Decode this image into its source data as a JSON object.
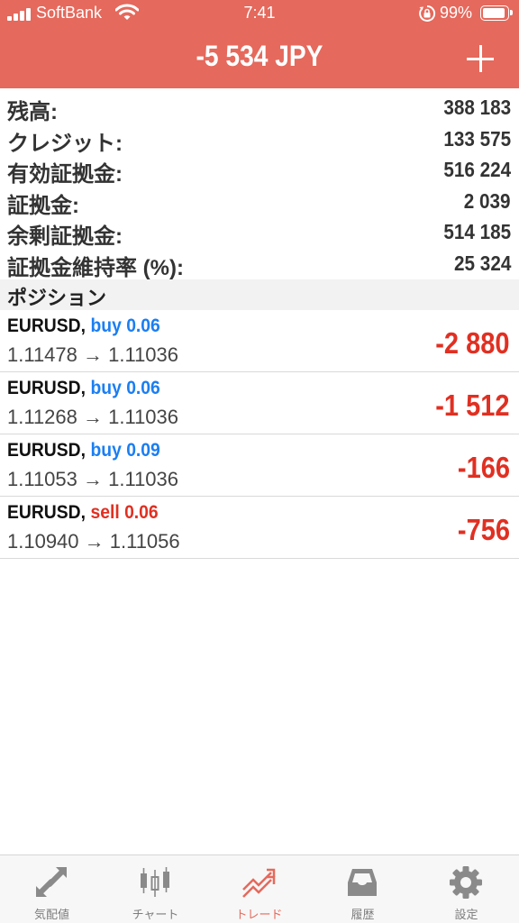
{
  "status_bar": {
    "carrier": "SoftBank",
    "time": "7:41",
    "battery_percent": "99%",
    "battery_level": 0.99
  },
  "header": {
    "title": "-5 534 JPY",
    "color": "#e5695c"
  },
  "summary": [
    {
      "label": "残高:",
      "value": "388 183"
    },
    {
      "label": "クレジット:",
      "value": "133 575"
    },
    {
      "label": "有効証拠金:",
      "value": "516 224"
    },
    {
      "label": "証拠金:",
      "value": "2 039"
    },
    {
      "label": "余剰証拠金:",
      "value": "514 185"
    },
    {
      "label": "証拠金維持率 (%):",
      "value": "25 324"
    }
  ],
  "positions_section": {
    "label": "ポジション"
  },
  "positions": [
    {
      "symbol": "EURUSD,",
      "side": "buy 0.06",
      "side_type": "buy",
      "prices": "1.11478 → 1.11036",
      "profit": "-2 880"
    },
    {
      "symbol": "EURUSD,",
      "side": "buy 0.06",
      "side_type": "buy",
      "prices": "1.11268 → 1.11036",
      "profit": "-1 512"
    },
    {
      "symbol": "EURUSD,",
      "side": "buy 0.09",
      "side_type": "buy",
      "prices": "1.11053 → 1.11036",
      "profit": "-166"
    },
    {
      "symbol": "EURUSD,",
      "side": "sell 0.06",
      "side_type": "sell",
      "prices": "1.10940 → 1.11056",
      "profit": "-756"
    }
  ],
  "tabbar": {
    "active": "trade",
    "items": [
      {
        "id": "quotes",
        "label": "気配値",
        "icon": "quotes-arrows-icon"
      },
      {
        "id": "chart",
        "label": "チャート",
        "icon": "candlestick-chart-icon"
      },
      {
        "id": "trade",
        "label": "トレード",
        "icon": "trade-trend-icon"
      },
      {
        "id": "history",
        "label": "履歴",
        "icon": "history-tray-icon"
      },
      {
        "id": "settings",
        "label": "設定",
        "icon": "gear-icon"
      }
    ]
  },
  "colors": {
    "accent": "#e5695c",
    "loss": "#e03022",
    "buy": "#1a7ef2",
    "sell": "#e03022"
  }
}
